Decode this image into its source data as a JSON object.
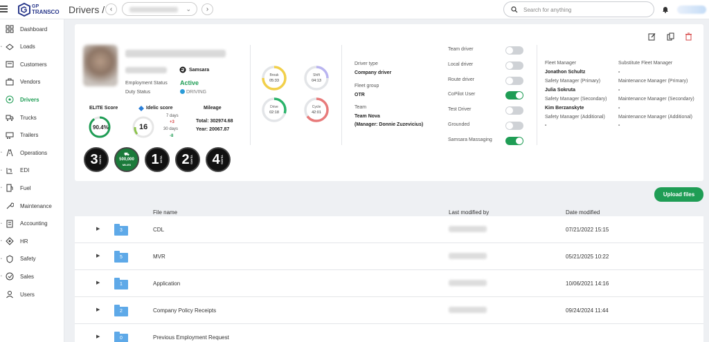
{
  "app": {
    "logo_line1": "GP",
    "logo_line2": "TRANSCO",
    "page_title": "Drivers /"
  },
  "search": {
    "placeholder": "Search for anything"
  },
  "sidebar": {
    "items": [
      {
        "label": "Dashboard",
        "icon": "dashboard-icon"
      },
      {
        "label": "Loads",
        "icon": "loads-icon"
      },
      {
        "label": "Customers",
        "icon": "customers-icon"
      },
      {
        "label": "Vendors",
        "icon": "vendors-icon"
      },
      {
        "label": "Drivers",
        "icon": "drivers-icon"
      },
      {
        "label": "Trucks",
        "icon": "trucks-icon"
      },
      {
        "label": "Trailers",
        "icon": "trailers-icon"
      },
      {
        "label": "Operations",
        "icon": "operations-icon"
      },
      {
        "label": "EDI",
        "icon": "edi-icon"
      },
      {
        "label": "Fuel",
        "icon": "fuel-icon"
      },
      {
        "label": "Maintenance",
        "icon": "maintenance-icon"
      },
      {
        "label": "Accounting",
        "icon": "accounting-icon"
      },
      {
        "label": "HR",
        "icon": "hr-icon"
      },
      {
        "label": "Safety",
        "icon": "safety-icon"
      },
      {
        "label": "Sales",
        "icon": "sales-icon"
      },
      {
        "label": "Users",
        "icon": "users-icon"
      }
    ],
    "active": "Drivers"
  },
  "profile": {
    "samsara_label": "Samsara",
    "employment_status_label": "Employment Status",
    "employment_status": "Active",
    "duty_status_label": "Duty Status",
    "duty_status": "DRIVING",
    "elite_score_label": "ELITE Score",
    "elite_score": "90.4%",
    "elite_score_value": 90.4,
    "idelic_label": "Idelic score",
    "idelic_score": "16",
    "idelic_7d_label": "7 days",
    "idelic_7d": "+3",
    "idelic_30d_label": "30 days",
    "idelic_30d": "-8",
    "mileage_label": "Mileage",
    "mileage_total": "Total: 302974.68",
    "mileage_year": "Year: 20067.87",
    "badges": [
      {
        "text": "3",
        "sub": "YEARS"
      },
      {
        "text": "500,000",
        "sub": "MILES"
      },
      {
        "text": "1",
        "sub": "YEAR"
      },
      {
        "text": "2",
        "sub": "YEARS"
      },
      {
        "text": "4",
        "sub": "YEARS"
      }
    ]
  },
  "hos": [
    {
      "label": "Break",
      "value": "05:33",
      "color": "#f2d04a"
    },
    {
      "label": "Shift",
      "value": "04:13",
      "color": "#b9b4f0"
    },
    {
      "label": "Drive",
      "value": "02:18",
      "color": "#2ab46a"
    },
    {
      "label": "Cycle",
      "value": "42:01",
      "color": "#e87a7a"
    }
  ],
  "details": {
    "driver_type_label": "Driver type",
    "driver_type": "Company driver",
    "fleet_group_label": "Fleet group",
    "fleet_group": "OTR",
    "team_label": "Team",
    "team": "Team Nova",
    "team_manager": "(Manager: Donnie Zuzevicius)"
  },
  "flags": [
    {
      "label": "Team driver",
      "on": false
    },
    {
      "label": "Local driver",
      "on": false
    },
    {
      "label": "Route driver",
      "on": false
    },
    {
      "label": "CoPilot User",
      "on": true
    },
    {
      "label": "Test Driver",
      "on": false
    },
    {
      "label": "Grounded",
      "on": false
    },
    {
      "label": "Samsara Massaging",
      "on": true
    }
  ],
  "managers": {
    "fleet_manager_label": "Fleet Manager",
    "fleet_manager": "Jonathon Schultz",
    "sub_fleet_manager_label": "Substitute Fleet Manager",
    "sub_fleet_manager": "-",
    "safety_primary_label": "Safety Manager (Primary)",
    "safety_primary": "Julia Sokruta",
    "maint_primary_label": "Maintenance Manager (Primary)",
    "maint_primary": "-",
    "safety_secondary_label": "Safety Manager (Secondary)",
    "safety_secondary": "Kim Berzanskyte",
    "maint_secondary_label": "Maintenance Manager (Secondary)",
    "maint_secondary": "-",
    "safety_additional_label": "Safety Manager (Additional)",
    "safety_additional": "-",
    "maint_additional_label": "Maintenance Manager (Additional)",
    "maint_additional": "-"
  },
  "files": {
    "upload_label": "Upload files",
    "col_name": "File name",
    "col_modified_by": "Last modified by",
    "col_date": "Date modified",
    "rows": [
      {
        "name": "CDL",
        "count": "3",
        "date": "07/21/2022 15:15"
      },
      {
        "name": "MVR",
        "count": "5",
        "date": "05/21/2025 10:22"
      },
      {
        "name": "Application",
        "count": "1",
        "date": "10/06/2021 14:16"
      },
      {
        "name": "Company Policy Receipts",
        "count": "2",
        "date": "09/24/2024 11:44"
      },
      {
        "name": "Previous Employment Request",
        "count": "0",
        "date": ""
      }
    ]
  }
}
